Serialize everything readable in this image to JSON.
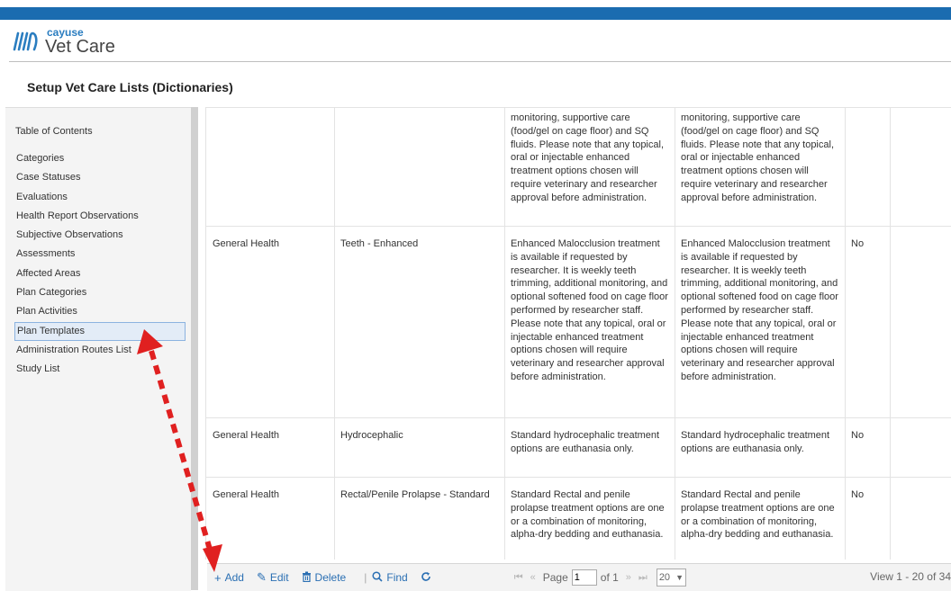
{
  "brand": {
    "name": "cayuse",
    "product": "Vet Care"
  },
  "page_title": "Setup Vet Care Lists (Dictionaries)",
  "sidebar": {
    "title": "Table of Contents",
    "items": [
      {
        "label": "Categories"
      },
      {
        "label": "Case Statuses"
      },
      {
        "label": "Evaluations"
      },
      {
        "label": "Health Report Observations"
      },
      {
        "label": "Subjective Observations"
      },
      {
        "label": "Assessments"
      },
      {
        "label": "Affected Areas"
      },
      {
        "label": "Plan Categories"
      },
      {
        "label": "Plan Activities"
      },
      {
        "label": "Plan Templates"
      },
      {
        "label": "Administration Routes List"
      },
      {
        "label": "Study List"
      }
    ],
    "active_index": 9
  },
  "grid": {
    "rows": [
      {
        "category": "",
        "name": "",
        "desc1": "monitoring, supportive care (food/gel on cage floor) and SQ fluids. Please note that any topical, oral or injectable enhanced treatment options chosen will require veterinary and researcher approval before administration.",
        "desc2": "monitoring, supportive care (food/gel on cage floor) and SQ fluids. Please note that any topical, oral or injectable enhanced treatment options chosen will require veterinary and researcher approval before administration.",
        "flag": ""
      },
      {
        "category": "General Health",
        "name": "Teeth - Enhanced",
        "desc1": "Enhanced Malocclusion treatment is available if requested by researcher. It is weekly teeth trimming, additional monitoring, and optional softened food on cage floor performed by researcher staff. Please note that any topical, oral or injectable enhanced treatment options chosen will require veterinary and researcher approval before administration.",
        "desc2": "Enhanced Malocclusion treatment is available if requested by researcher. It is weekly teeth trimming, additional monitoring, and optional softened food on cage floor performed by researcher staff. Please note that any topical, oral or injectable enhanced treatment options chosen will require veterinary and researcher approval before administration.",
        "flag": "No"
      },
      {
        "category": "General Health",
        "name": "Hydrocephalic",
        "desc1": "Standard hydrocephalic treatment options are euthanasia only.",
        "desc2": "Standard hydrocephalic treatment options are euthanasia only.",
        "flag": "No"
      },
      {
        "category": "General Health",
        "name": "Rectal/Penile Prolapse - Standard",
        "desc1": "Standard Rectal and penile prolapse treatment options are one or a combination of monitoring, alpha-dry bedding and euthanasia.",
        "desc2": "Standard Rectal and penile prolapse treatment options are one or a combination of monitoring, alpha-dry bedding and euthanasia.",
        "flag": "No"
      }
    ]
  },
  "pager": {
    "add_label": "Add",
    "edit_label": "Edit",
    "delete_label": "Delete",
    "find_label": "Find",
    "page_label": "Page",
    "page_value": "1",
    "of_label": "of 1",
    "page_size": "20",
    "view_info": "View 1 - 20 of 34"
  },
  "colors": {
    "accent": "#1b6cb0",
    "annotation_arrow": "#e02020"
  },
  "icons": {
    "add": "plus-icon",
    "edit": "pencil-icon",
    "delete": "trash-icon",
    "find": "magnifier-icon",
    "refresh": "refresh-icon"
  }
}
